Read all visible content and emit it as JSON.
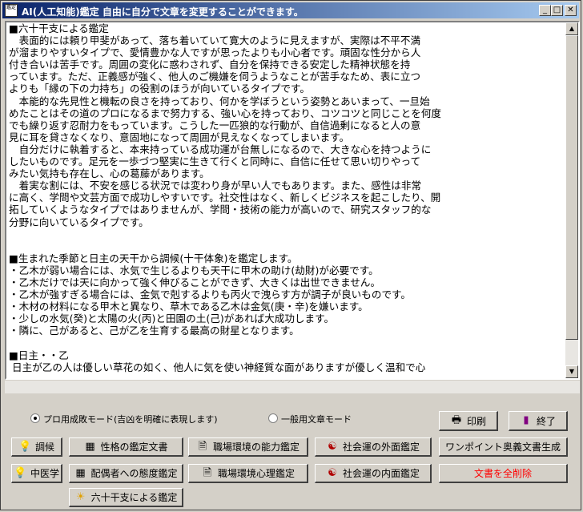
{
  "window": {
    "title": "AI(人工知能)鑑定 自由に自分で文章を変更することができます。",
    "app_icon_text": "鑑定"
  },
  "content_lines": [
    "■六十干支による鑑定",
    "　表面的には頼り甲斐があって、落ち着いていて寛大のように見えますが、実際は不平不満",
    "が溜まりやすいタイプで、愛情豊かな人ですが思ったよりも小心者です。頑固な性分から人",
    "付き合いは苦手です。周囲の変化に惑わされず、自分を保持できる安定した精神状態を持",
    "っています。ただ、正義感が強く、他人のご機嫌を伺うようなことが苦手なため、表に立つ",
    "よりも「縁の下の力持ち」の役割のほうが向いているタイプです。",
    "　本能的な先見性と機転の良さを持っており、何かを学ぼうという姿勢とあいまって、一旦始",
    "めたことはその道のプロになるまで努力する、強い心を持っており、コツコツと同じことを何度",
    "でも繰り返す忍耐力をもっています。こうした一匹狼的な行動が、自信過剰になると人の意",
    "見に耳を貸さなくなり、意固地になって周囲が見えなくなってしまいます。",
    "　自分だけに執着すると、本来持っている成功運が台無しになるので、大きな心を持つように",
    "したいものです。足元を一歩づつ堅実に生きて行くと同時に、自信に任せて思い切りやって",
    "みたい気持も存在し、心の葛藤があります。",
    "　着実な割には、不安を感じる状況では変わり身が早い人でもあります。また、感性は非常",
    "に高く、学問や文芸方面で成功しやすいです。社交性はなく、新しくビジネスを起こしたり、開",
    "拓していくようなタイプではありませんが、学問・技術の能力が高いので、研究スタッフ的な",
    "分野に向いているタイプです。",
    "",
    "",
    "■生まれた季節と日主の天干から調候(十干体象)を鑑定します。",
    "・乙木が弱い場合には、水気で生じるよりも天干に甲木の助け(劫財)が必要です。",
    "・乙木だけでは天に向かって強く伸びることができず、大きくは出世できません。",
    "・乙木が強すぎる場合には、金気で剋するよりも丙火で洩らす方が調子が良いものです。",
    "・木材の材料になる甲木と異なり、草木である乙木は金気(庚・辛)を嫌います。",
    "・少しの水気(癸)と太陽の火(丙)と田園の土(己)があれば大成功します。",
    "・隣に、己があると、己が乙を生育する最高の財星となります。",
    "",
    "■日主・・乙",
    " 日主が乙の人は優しい草花の如く、他人に気を使い神経質な面がありますが優しく温和で心"
  ],
  "modes": {
    "professional": "プロ用成敗モード(吉凶を明確に表現します)",
    "general": "一般用文章モード",
    "selected": "professional"
  },
  "buttons": {
    "print": "印刷",
    "exit": "終了",
    "chouko": "調候",
    "personality": "性格の鑑定文書",
    "work_ability": "職場環境の能力鑑定",
    "social_outer": "社会運の外面鑑定",
    "one_point": "ワンポイント奥義文書生成",
    "tcm": "中医学",
    "spouse_attitude": "配偶者への態度鑑定",
    "work_psych": "職場環境心理鑑定",
    "social_inner": "社会運の内面鑑定",
    "delete_all": "文書を全削除",
    "sixty_kanshi": "六十干支による鑑定"
  },
  "colors": {
    "titlebar_start": "#0a246a",
    "titlebar_end": "#a6caf0",
    "danger_text": "#ff0000"
  }
}
